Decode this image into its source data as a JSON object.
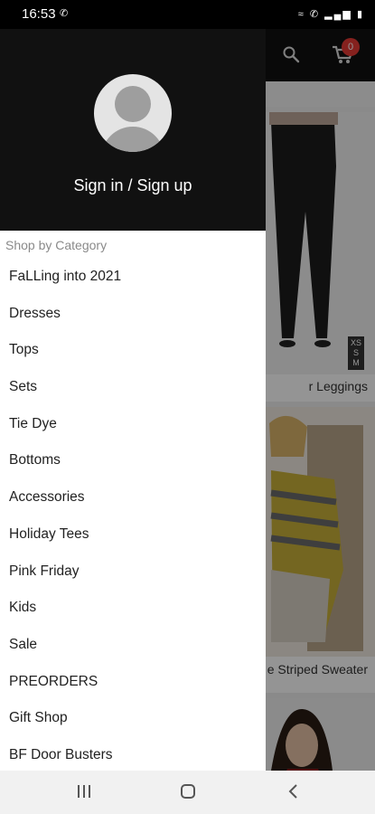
{
  "status_bar": {
    "time": "16:53",
    "call_indicator": "call-icon",
    "indicators": [
      "wifi-icon",
      "call-signal-icon",
      "signal-bars-icon",
      "battery-icon"
    ]
  },
  "header": {
    "cart_count": "0",
    "colors": {
      "background": "#111111",
      "badge": "#e53935"
    }
  },
  "products": [
    {
      "name": "r Leggings",
      "sizes": [
        "XS",
        "S",
        "M"
      ]
    },
    {
      "name": "e Striped Sweater"
    }
  ],
  "drawer": {
    "signin_label": "Sign in / Sign up",
    "category_heading": "Shop by Category",
    "categories": [
      "FaLLing into 2021",
      "Dresses",
      "Tops",
      "Sets",
      "Tie Dye",
      "Bottoms",
      "Accessories",
      "Holiday Tees",
      "Pink Friday",
      "Kids",
      "Sale",
      "PREORDERS",
      "Gift Shop",
      "BF Door Busters"
    ]
  },
  "nav_bar": {
    "buttons": [
      "recent-apps-icon",
      "home-icon",
      "back-icon"
    ]
  }
}
